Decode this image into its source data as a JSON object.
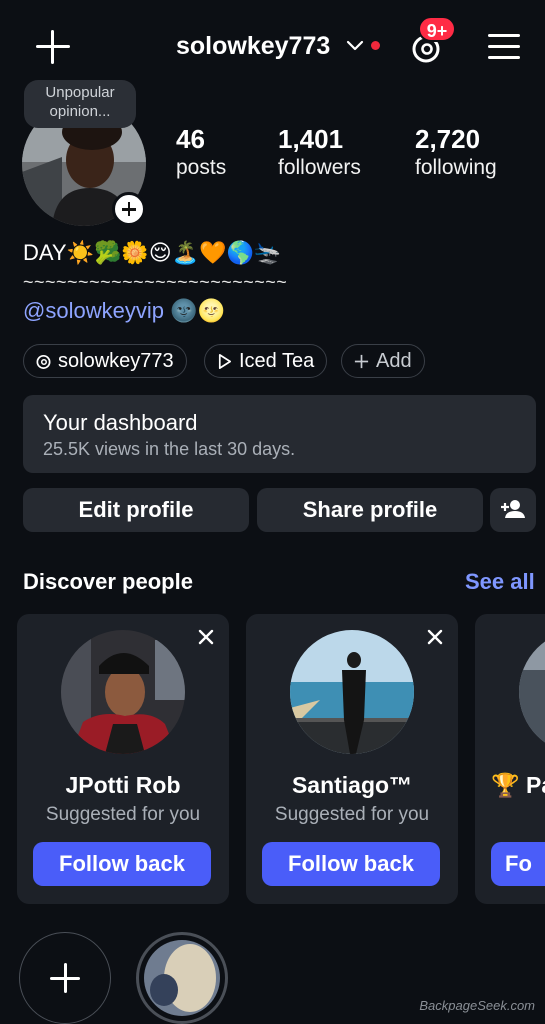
{
  "header": {
    "username": "solowkey773",
    "notification_badge": "9+",
    "icons": [
      "plus-icon",
      "chevron-down-icon",
      "threads-icon",
      "menu-icon"
    ],
    "accent_badge_color": "#ff2b45"
  },
  "profile": {
    "note": "Unpopular opinion...",
    "stats": [
      {
        "value": "46",
        "label": "posts"
      },
      {
        "value": "1,401",
        "label": "followers"
      },
      {
        "value": "2,720",
        "label": "following"
      }
    ],
    "bio_line1": "DAY☀️🥦🌼😌🏝️🧡🌎🛬",
    "bio_line2": "~~~~~~~~~~~~~~~~~~~~~~~~",
    "bio_handle": "@solowkeyvip 🌚🌝"
  },
  "chips": [
    {
      "label": "solowkey773",
      "icon": "threads-icon"
    },
    {
      "label": "Iced Tea",
      "icon": "play-icon"
    },
    {
      "label": "Add",
      "icon": "plus-icon"
    }
  ],
  "dashboard": {
    "title": "Your dashboard",
    "subtitle": "25.5K views in the last 30 days."
  },
  "actions": {
    "edit": "Edit profile",
    "share": "Share profile"
  },
  "discover": {
    "title": "Discover people",
    "see_all": "See all",
    "cards": [
      {
        "name": "JPotti Rob",
        "sub": "Suggested for you",
        "button": "Follow back"
      },
      {
        "name": "Santiago™",
        "sub": "Suggested for you",
        "button": "Follow back"
      },
      {
        "name": "🏆 Pa",
        "sub": "",
        "button": "Fo"
      }
    ],
    "accent_color": "#4a5df9"
  },
  "watermark": "BackpageSeek.com"
}
